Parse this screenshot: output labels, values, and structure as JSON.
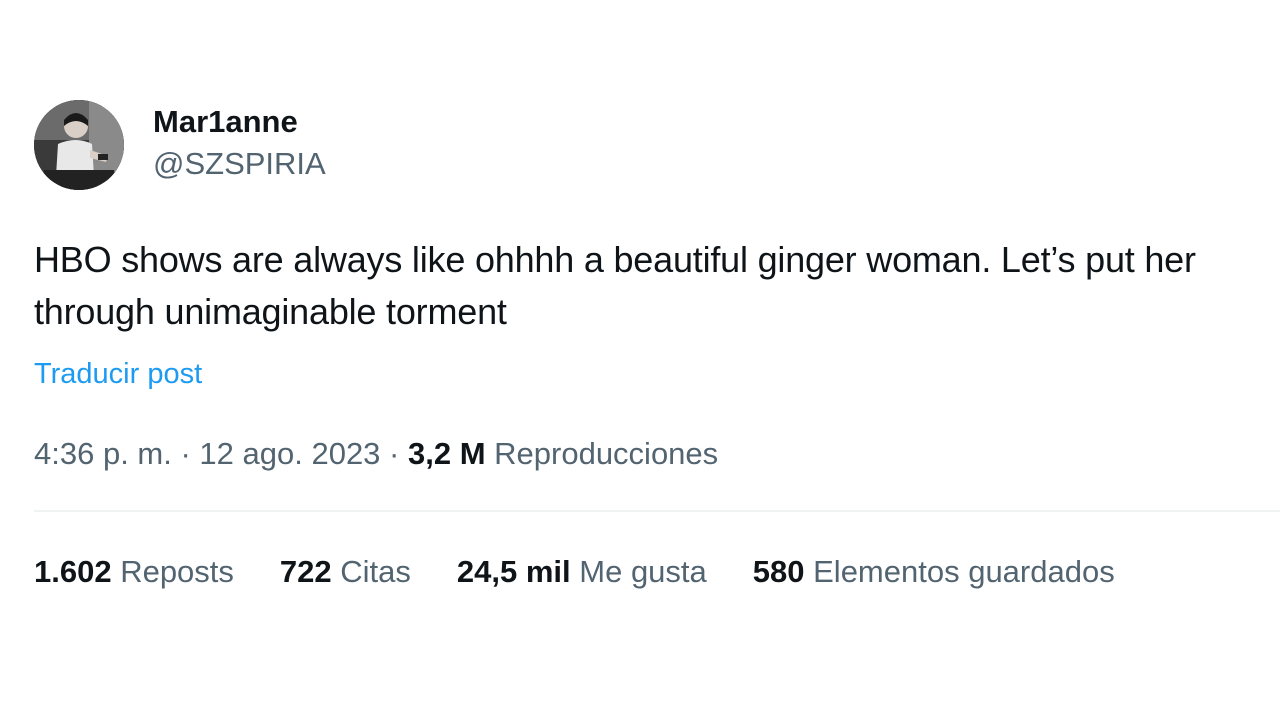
{
  "author": {
    "display_name": "Mar1anne",
    "handle": "@SZSPIRIA"
  },
  "post": {
    "text": "HBO shows are always like ohhhh a beautiful ginger woman. Let’s put her through unimaginable torment",
    "translate_label": "Traducir post"
  },
  "meta": {
    "time": "4:36 p. m.",
    "separator1": " · ",
    "date": "12 ago. 2023",
    "separator2": " · ",
    "views_count": "3,2 M",
    "views_label": " Reproducciones"
  },
  "stats": [
    {
      "count": "1.602",
      "label": " Reposts"
    },
    {
      "count": "722",
      "label": " Citas"
    },
    {
      "count": "24,5 mil",
      "label": " Me gusta"
    },
    {
      "count": "580",
      "label": " Elementos guardados"
    }
  ],
  "colors": {
    "text_primary": "#0f1419",
    "text_secondary": "#536471",
    "link": "#1d9bf0",
    "divider": "#eff3f4"
  }
}
